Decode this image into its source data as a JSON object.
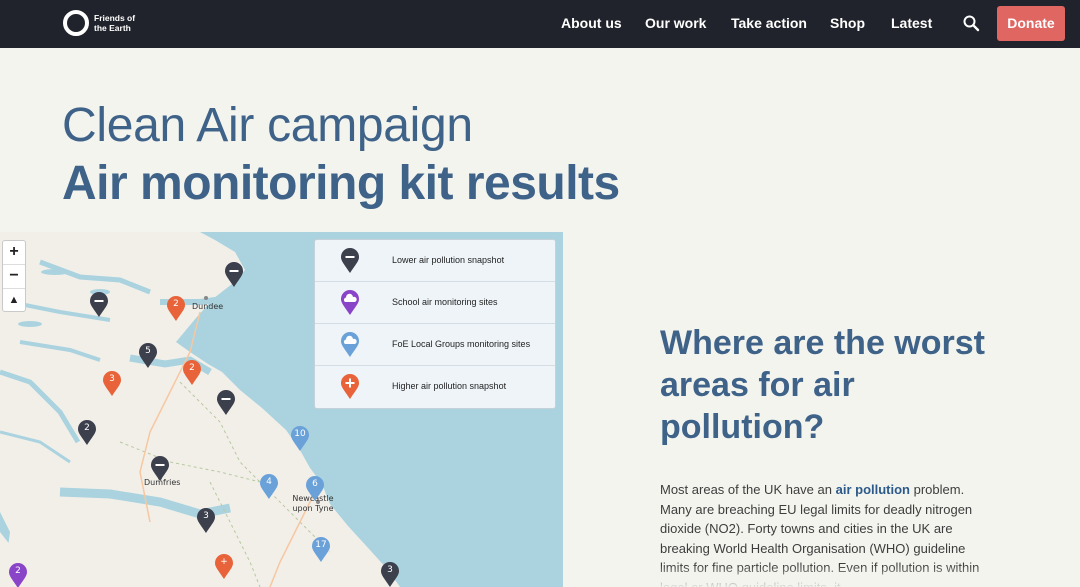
{
  "header": {
    "logo_text": "Friends of the Earth",
    "nav": [
      "About us",
      "Our work",
      "Take action",
      "Shop",
      "Latest"
    ],
    "donate_label": "Donate"
  },
  "hero": {
    "line1": "Clean Air campaign",
    "line2": "Air monitoring kit results"
  },
  "map": {
    "zoom_in": "+",
    "zoom_out": "−",
    "reset": "▲",
    "towns": [
      "Dundee",
      "Dumfries",
      "Newcastle upon Tyne"
    ],
    "legend": [
      {
        "label": "Lower air pollution snapshot",
        "color": "#3c3f4c",
        "icon": "minus-icon"
      },
      {
        "label": "School air monitoring sites",
        "color": "#8a44c8",
        "icon": "cloud-icon"
      },
      {
        "label": "FoE Local Groups monitoring sites",
        "color": "#6aa1d8",
        "icon": "cloud-icon"
      },
      {
        "label": "Higher air pollution snapshot",
        "color": "#e8633a",
        "icon": "plus-icon"
      }
    ],
    "markers": [
      {
        "label": "2",
        "kind": "higher"
      },
      {
        "label": "",
        "kind": "lower"
      },
      {
        "label": "",
        "kind": "lower"
      },
      {
        "label": "5",
        "kind": "lower"
      },
      {
        "label": "3",
        "kind": "higher"
      },
      {
        "label": "2",
        "kind": "higher"
      },
      {
        "label": "",
        "kind": "lower"
      },
      {
        "label": "2",
        "kind": "lower"
      },
      {
        "label": "10",
        "kind": "group"
      },
      {
        "label": "",
        "kind": "lower"
      },
      {
        "label": "4",
        "kind": "group"
      },
      {
        "label": "6",
        "kind": "group"
      },
      {
        "label": "3",
        "kind": "lower"
      },
      {
        "label": "17",
        "kind": "group"
      },
      {
        "label": "+",
        "kind": "higher"
      },
      {
        "label": "3",
        "kind": "lower"
      },
      {
        "label": "2",
        "kind": "school"
      }
    ]
  },
  "article": {
    "heading": "Where are the worst areas for air pollution?",
    "p_before": "Most areas of the UK have an ",
    "p_link": "air pollution",
    "p_after": " problem. Many are breaching EU legal limits for deadly nitrogen dioxide (NO2). Forty towns and cities in the UK are breaking World Health Organisation (WHO) guideline limits for fine particle pollution. Even if pollution is within legal or WHO guideline limits, it"
  },
  "colors": {
    "nav_bg": "#20232b",
    "heading": "#3e6288",
    "donate": "#e06662",
    "page_bg": "#f4f4ef",
    "sea": "#aad3df",
    "land": "#f2efe9"
  }
}
